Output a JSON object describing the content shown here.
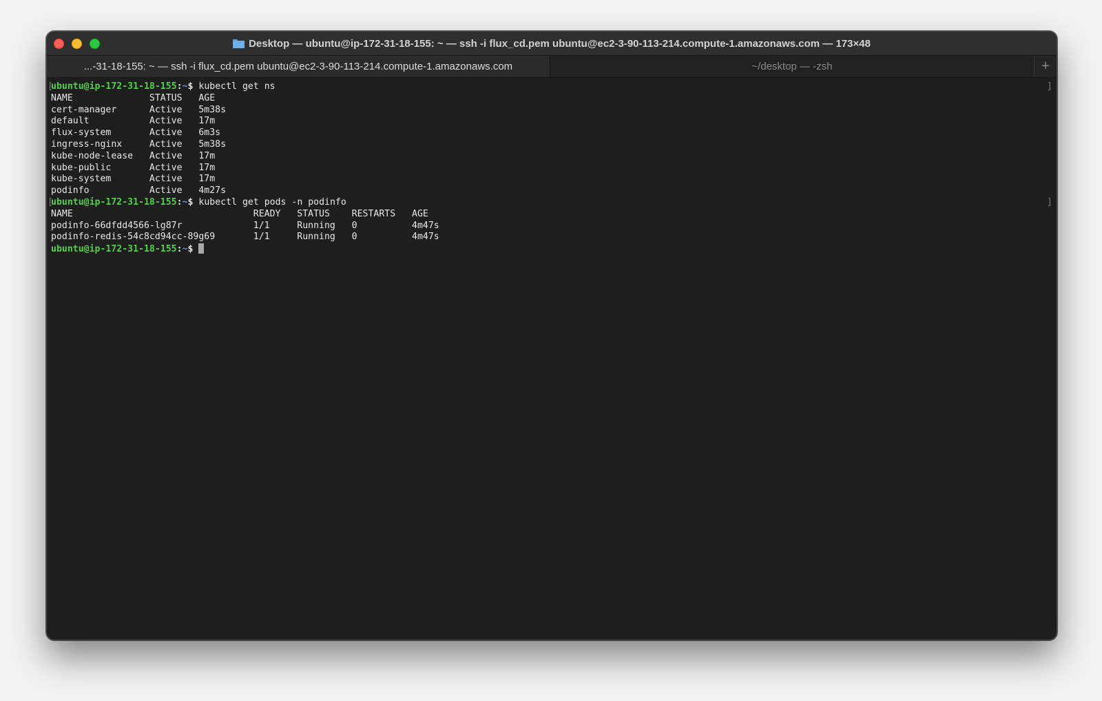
{
  "window": {
    "title": "Desktop — ubuntu@ip-172-31-18-155: ~ — ssh -i flux_cd.pem ubuntu@ec2-3-90-113-214.compute-1.amazonaws.com — 173×48",
    "title_icon": "folder-icon"
  },
  "tabs": [
    {
      "label": "...-31-18-155: ~ — ssh -i flux_cd.pem ubuntu@ec2-3-90-113-214.compute-1.amazonaws.com",
      "active": true
    },
    {
      "label": "~/desktop — -zsh",
      "active": false
    }
  ],
  "tab_add_label": "+",
  "prompt": {
    "user_host": "ubuntu@ip-172-31-18-155",
    "sep": ":",
    "path": "~",
    "symbol": "$ "
  },
  "commands": {
    "get_ns": "kubectl get ns",
    "get_pods": "kubectl get pods -n podinfo"
  },
  "ns_output": [
    "NAME              STATUS   AGE",
    "cert-manager      Active   5m38s",
    "default           Active   17m",
    "flux-system       Active   6m3s",
    "ingress-nginx     Active   5m38s",
    "kube-node-lease   Active   17m",
    "kube-public       Active   17m",
    "kube-system       Active   17m",
    "podinfo           Active   4m27s"
  ],
  "pods_output": [
    "NAME                                 READY   STATUS    RESTARTS   AGE",
    "podinfo-66dfdd4566-lg87r             1/1     Running   0          4m47s",
    "podinfo-redis-54c8cd94cc-89g69       1/1     Running   0          4m47s"
  ],
  "colors": {
    "prompt_user": "#52d14a",
    "prompt_path": "#6a8fd8",
    "background": "#1e1e1e",
    "text": "#e8e8e8"
  }
}
